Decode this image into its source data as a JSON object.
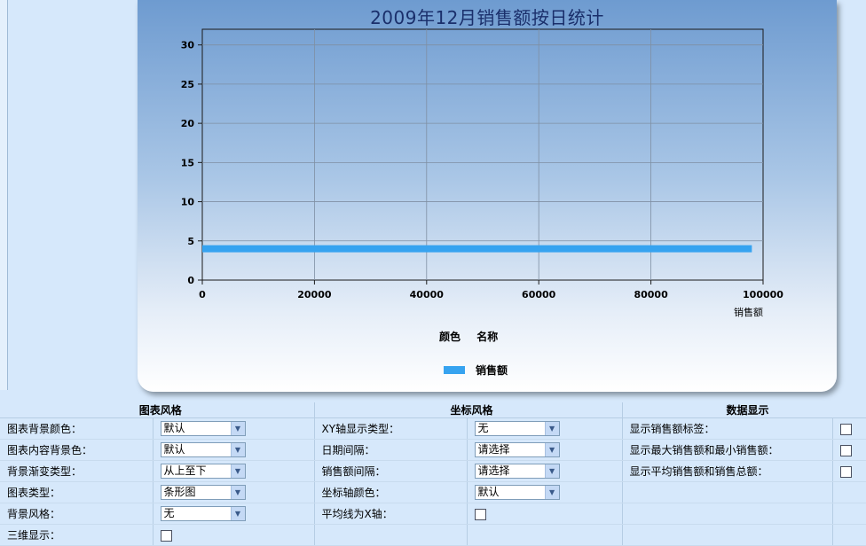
{
  "chart_data": {
    "type": "bar",
    "orientation": "horizontal",
    "title": "2009年12月销售额按日统计",
    "xlabel": "销售额",
    "ylabel": "",
    "xlim": [
      0,
      100000
    ],
    "ylim": [
      0,
      32
    ],
    "xticks": [
      0,
      20000,
      40000,
      60000,
      80000,
      100000
    ],
    "yticks": [
      0,
      5,
      10,
      15,
      20,
      25,
      30
    ],
    "grid": true,
    "categories": [
      4
    ],
    "series": [
      {
        "name": "销售额",
        "values": [
          98000
        ],
        "color": "#36a3f0"
      }
    ],
    "legend": {
      "heading": [
        "颜色",
        "名称"
      ],
      "placement": "bottom-center"
    }
  },
  "settings": {
    "sections": [
      "图表风格",
      "坐标风格",
      "数据显示"
    ],
    "chart_style": [
      {
        "label": "图表背景颜色：",
        "value": "默认"
      },
      {
        "label": "图表内容背景色：",
        "value": "默认"
      },
      {
        "label": "背景渐变类型：",
        "value": "从上至下"
      },
      {
        "label": "图表类型：",
        "value": "条形图"
      },
      {
        "label": "背景风格：",
        "value": "无"
      },
      {
        "label": "三维显示：",
        "checked": false
      }
    ],
    "axis_style": [
      {
        "label": "XY轴显示类型：",
        "value": "无"
      },
      {
        "label": "日期间隔：",
        "value": "请选择"
      },
      {
        "label": "销售额间隔：",
        "value": "请选择"
      },
      {
        "label": "坐标轴颜色：",
        "value": "默认"
      },
      {
        "label": "平均线为X轴：",
        "checked": false
      }
    ],
    "data_display": [
      {
        "label": "显示销售额标签：",
        "checked": false
      },
      {
        "label": "显示最大销售额和最小销售额：",
        "checked": false
      },
      {
        "label": "显示平均销售额和销售总额：",
        "checked": false
      }
    ]
  },
  "colors": {
    "accent": "#36a3f0",
    "title": "#1a2f6b",
    "background": "#d6e8fb"
  }
}
